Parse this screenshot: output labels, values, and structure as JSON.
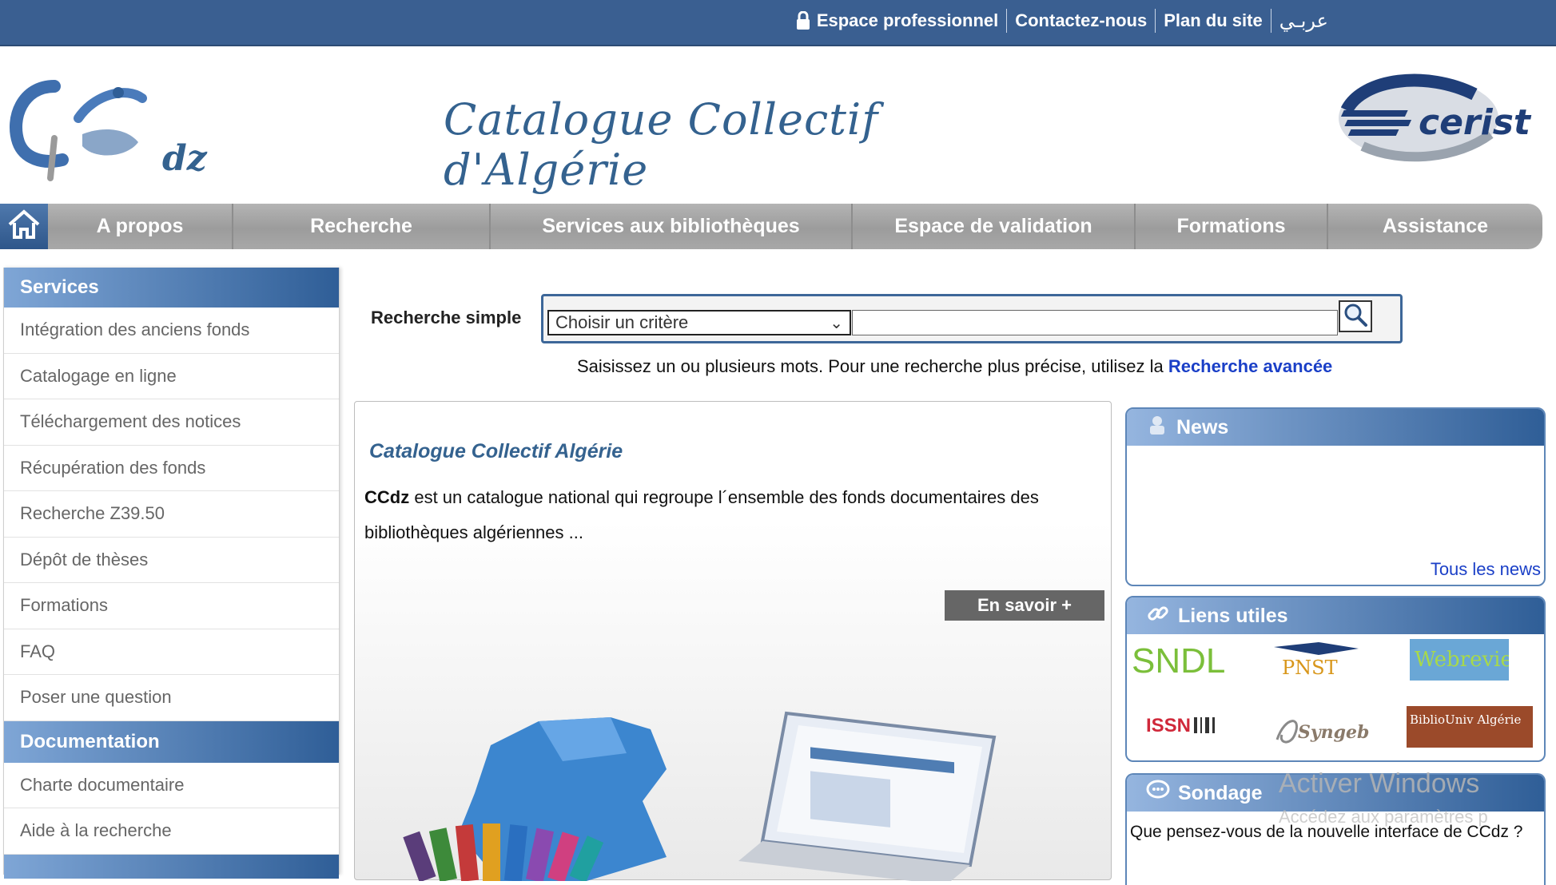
{
  "topbar": {
    "links": [
      "Espace professionnel",
      "Contactez-nous",
      "Plan du site",
      "عربـي"
    ]
  },
  "header": {
    "title": "Catalogue Collectif d'Algérie",
    "logo_left_text": "dz",
    "logo_right_text": "cerist"
  },
  "nav": {
    "items": [
      "A propos",
      "Recherche",
      "Services aux bibliothèques",
      "Espace de validation",
      "Formations",
      "Assistance"
    ]
  },
  "sidebar": {
    "services_title": "Services",
    "services_items": [
      "Intégration des anciens fonds",
      "Catalogage en ligne",
      "Téléchargement des notices",
      "Récupération des fonds",
      "Recherche Z39.50",
      "Dépôt de thèses",
      "Formations",
      "FAQ",
      "Poser une question"
    ],
    "documentation_title": "Documentation",
    "documentation_items": [
      "Charte documentaire",
      "Aide à la recherche"
    ]
  },
  "search": {
    "label": "Recherche simple",
    "select_value": "Choisir un critère",
    "hint": "Saisissez un ou plusieurs mots. Pour une recherche plus précise, utilisez la",
    "advanced_link": "Recherche avancée"
  },
  "center": {
    "title": "Catalogue Collectif Algérie",
    "text_bold": "CCdz",
    "text": " est un catalogue national qui regroupe l´ensemble des fonds documentaires des bibliothèques algériennes ...",
    "more_button": "En savoir +"
  },
  "news": {
    "title": "News",
    "all_link": "Tous les news"
  },
  "liens": {
    "title": "Liens utiles",
    "logos": [
      "SNDL",
      "PNST",
      "Webreview",
      "ISSN",
      "Syngeb",
      "BiblioUniv Algérie"
    ]
  },
  "sondage": {
    "title": "Sondage",
    "question": "Que pensez-vous de la nouvelle interface de CCdz ?"
  },
  "watermark": {
    "line1": "Activer Windows",
    "line2": "Accédez aux paramètres p"
  },
  "colors": {
    "topbar": "#3a5f91",
    "title": "#34628f",
    "nav": "#a8a8a8",
    "link": "#1a3fc7"
  }
}
